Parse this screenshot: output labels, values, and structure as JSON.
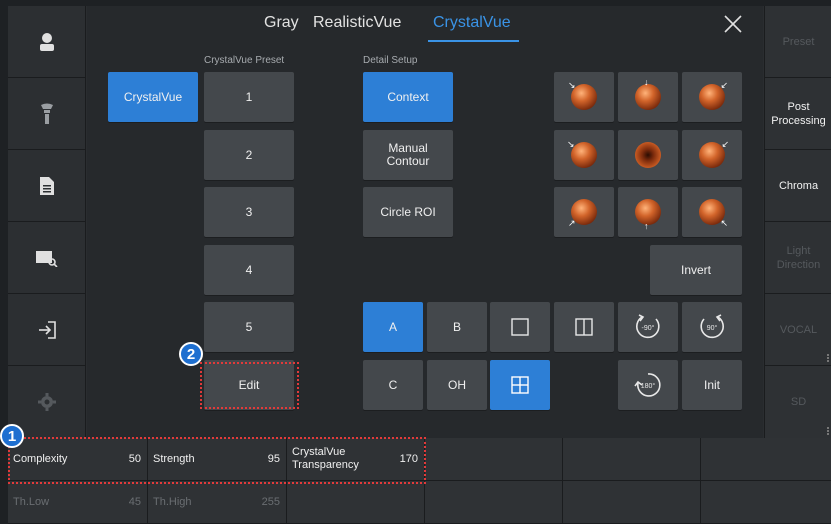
{
  "tabs": [
    {
      "label": "Gray",
      "active": false
    },
    {
      "label": "RealisticVue",
      "active": false
    },
    {
      "label": "CrystalVue",
      "active": true
    }
  ],
  "sections": {
    "preset_label": "CrystalVue Preset",
    "detail_label": "Detail Setup"
  },
  "mode_button": "CrystalVue",
  "presets": [
    "1",
    "2",
    "3",
    "4",
    "5"
  ],
  "edit_button": "Edit",
  "detail": {
    "context": "Context",
    "manual_contour": "Manual\nContour",
    "circle_roi": "Circle ROI",
    "invert": "Invert",
    "init": "Init"
  },
  "views": {
    "a": "A",
    "b": "B",
    "c": "C",
    "oh": "OH",
    "rot_left": "-90°",
    "rot_right": "90°",
    "rot_180": "180°"
  },
  "right_sidebar": [
    {
      "label": "Preset",
      "enabled": false
    },
    {
      "label": "Post\nProcessing",
      "enabled": true
    },
    {
      "label": "Chroma",
      "enabled": true
    },
    {
      "label": "Light\nDirection",
      "enabled": false
    },
    {
      "label": "VOCAL",
      "enabled": false
    },
    {
      "label": "SD",
      "enabled": false
    }
  ],
  "left_sidebar_icons": [
    "patient-icon",
    "probe-icon",
    "report-icon",
    "review-icon",
    "exit-icon",
    "settings-icon"
  ],
  "params": [
    {
      "name": "Complexity",
      "value": "50",
      "enabled": true
    },
    {
      "name": "Strength",
      "value": "95",
      "enabled": true
    },
    {
      "name": "CrystalVue\nTransparency",
      "value": "170",
      "enabled": true
    },
    {
      "name": "Th.Low",
      "value": "45",
      "enabled": false
    },
    {
      "name": "Th.High",
      "value": "255",
      "enabled": false
    }
  ],
  "badges": [
    "1",
    "2"
  ],
  "colors": {
    "accent": "#2d7fd6",
    "highlight": "#e23a3a"
  }
}
